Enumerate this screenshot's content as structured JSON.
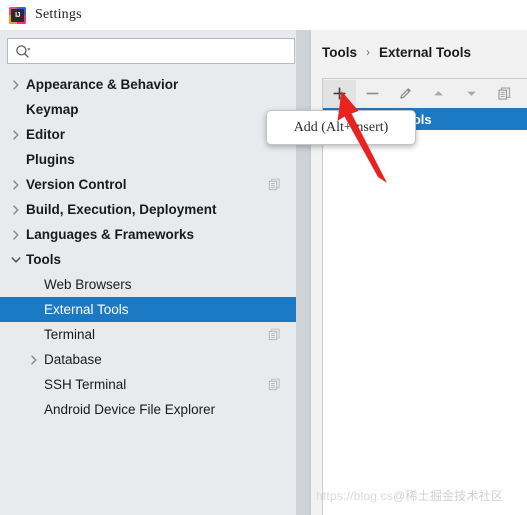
{
  "window": {
    "title": "Settings",
    "app_icon": "intellij-idea-icon",
    "icon_text": "IJ"
  },
  "search": {
    "value": "",
    "placeholder": "",
    "icon": "search-icon"
  },
  "sidebar": {
    "items": [
      {
        "label": "Appearance & Behavior",
        "twisty": "right",
        "bold": true,
        "indent": 0,
        "selected": false,
        "badge": false
      },
      {
        "label": "Keymap",
        "twisty": "none",
        "bold": true,
        "indent": 0,
        "selected": false,
        "badge": false
      },
      {
        "label": "Editor",
        "twisty": "right",
        "bold": true,
        "indent": 0,
        "selected": false,
        "badge": false
      },
      {
        "label": "Plugins",
        "twisty": "none",
        "bold": true,
        "indent": 0,
        "selected": false,
        "badge": false
      },
      {
        "label": "Version Control",
        "twisty": "right",
        "bold": true,
        "indent": 0,
        "selected": false,
        "badge": true
      },
      {
        "label": "Build, Execution, Deployment",
        "twisty": "right",
        "bold": true,
        "indent": 0,
        "selected": false,
        "badge": false
      },
      {
        "label": "Languages & Frameworks",
        "twisty": "right",
        "bold": true,
        "indent": 0,
        "selected": false,
        "badge": false
      },
      {
        "label": "Tools",
        "twisty": "down",
        "bold": true,
        "indent": 0,
        "selected": false,
        "badge": false
      },
      {
        "label": "Web Browsers",
        "twisty": "none",
        "bold": false,
        "indent": 1,
        "selected": false,
        "badge": false
      },
      {
        "label": "External Tools",
        "twisty": "none",
        "bold": false,
        "indent": 1,
        "selected": true,
        "badge": false
      },
      {
        "label": "Terminal",
        "twisty": "none",
        "bold": false,
        "indent": 1,
        "selected": false,
        "badge": true
      },
      {
        "label": "Database",
        "twisty": "right",
        "bold": false,
        "indent": 1,
        "selected": false,
        "badge": false
      },
      {
        "label": "SSH Terminal",
        "twisty": "none",
        "bold": false,
        "indent": 1,
        "selected": false,
        "badge": true
      },
      {
        "label": "Android Device File Explorer",
        "twisty": "none",
        "bold": false,
        "indent": 1,
        "selected": false,
        "badge": false
      }
    ]
  },
  "main": {
    "breadcrumb": {
      "parent": "Tools",
      "separator": "›",
      "current": "External Tools"
    },
    "toolbar": {
      "buttons": [
        {
          "name": "add-button",
          "icon": "plus-icon",
          "label": "Add",
          "active": true
        },
        {
          "name": "remove-button",
          "icon": "minus-icon",
          "label": "Remove",
          "active": false
        },
        {
          "name": "edit-button",
          "icon": "pencil-icon",
          "label": "Edit",
          "active": false
        },
        {
          "name": "move-up-button",
          "icon": "arrow-up-icon",
          "label": "Move Up",
          "active": false
        },
        {
          "name": "move-down-button",
          "icon": "arrow-down-icon",
          "label": "Move Down",
          "active": false
        },
        {
          "name": "copy-button",
          "icon": "copy-icon",
          "label": "Copy",
          "active": false
        }
      ]
    },
    "list": {
      "rows": [
        {
          "label": "External Tools",
          "selected": true
        }
      ]
    }
  },
  "tooltip": {
    "text": "Add (Alt+Insert)",
    "visible": true
  },
  "annotation": {
    "arrow": "red-pointer-arrow",
    "color": "#e8231f"
  },
  "watermark": {
    "url": "https://blog.cs",
    "handle": "@稀土掘金技术社区"
  },
  "colors": {
    "selection": "#1c7ac4",
    "sidebar_bg": "#e8eaed",
    "panel_bg": "#f2f2f2",
    "annotation_red": "#e8231f"
  }
}
